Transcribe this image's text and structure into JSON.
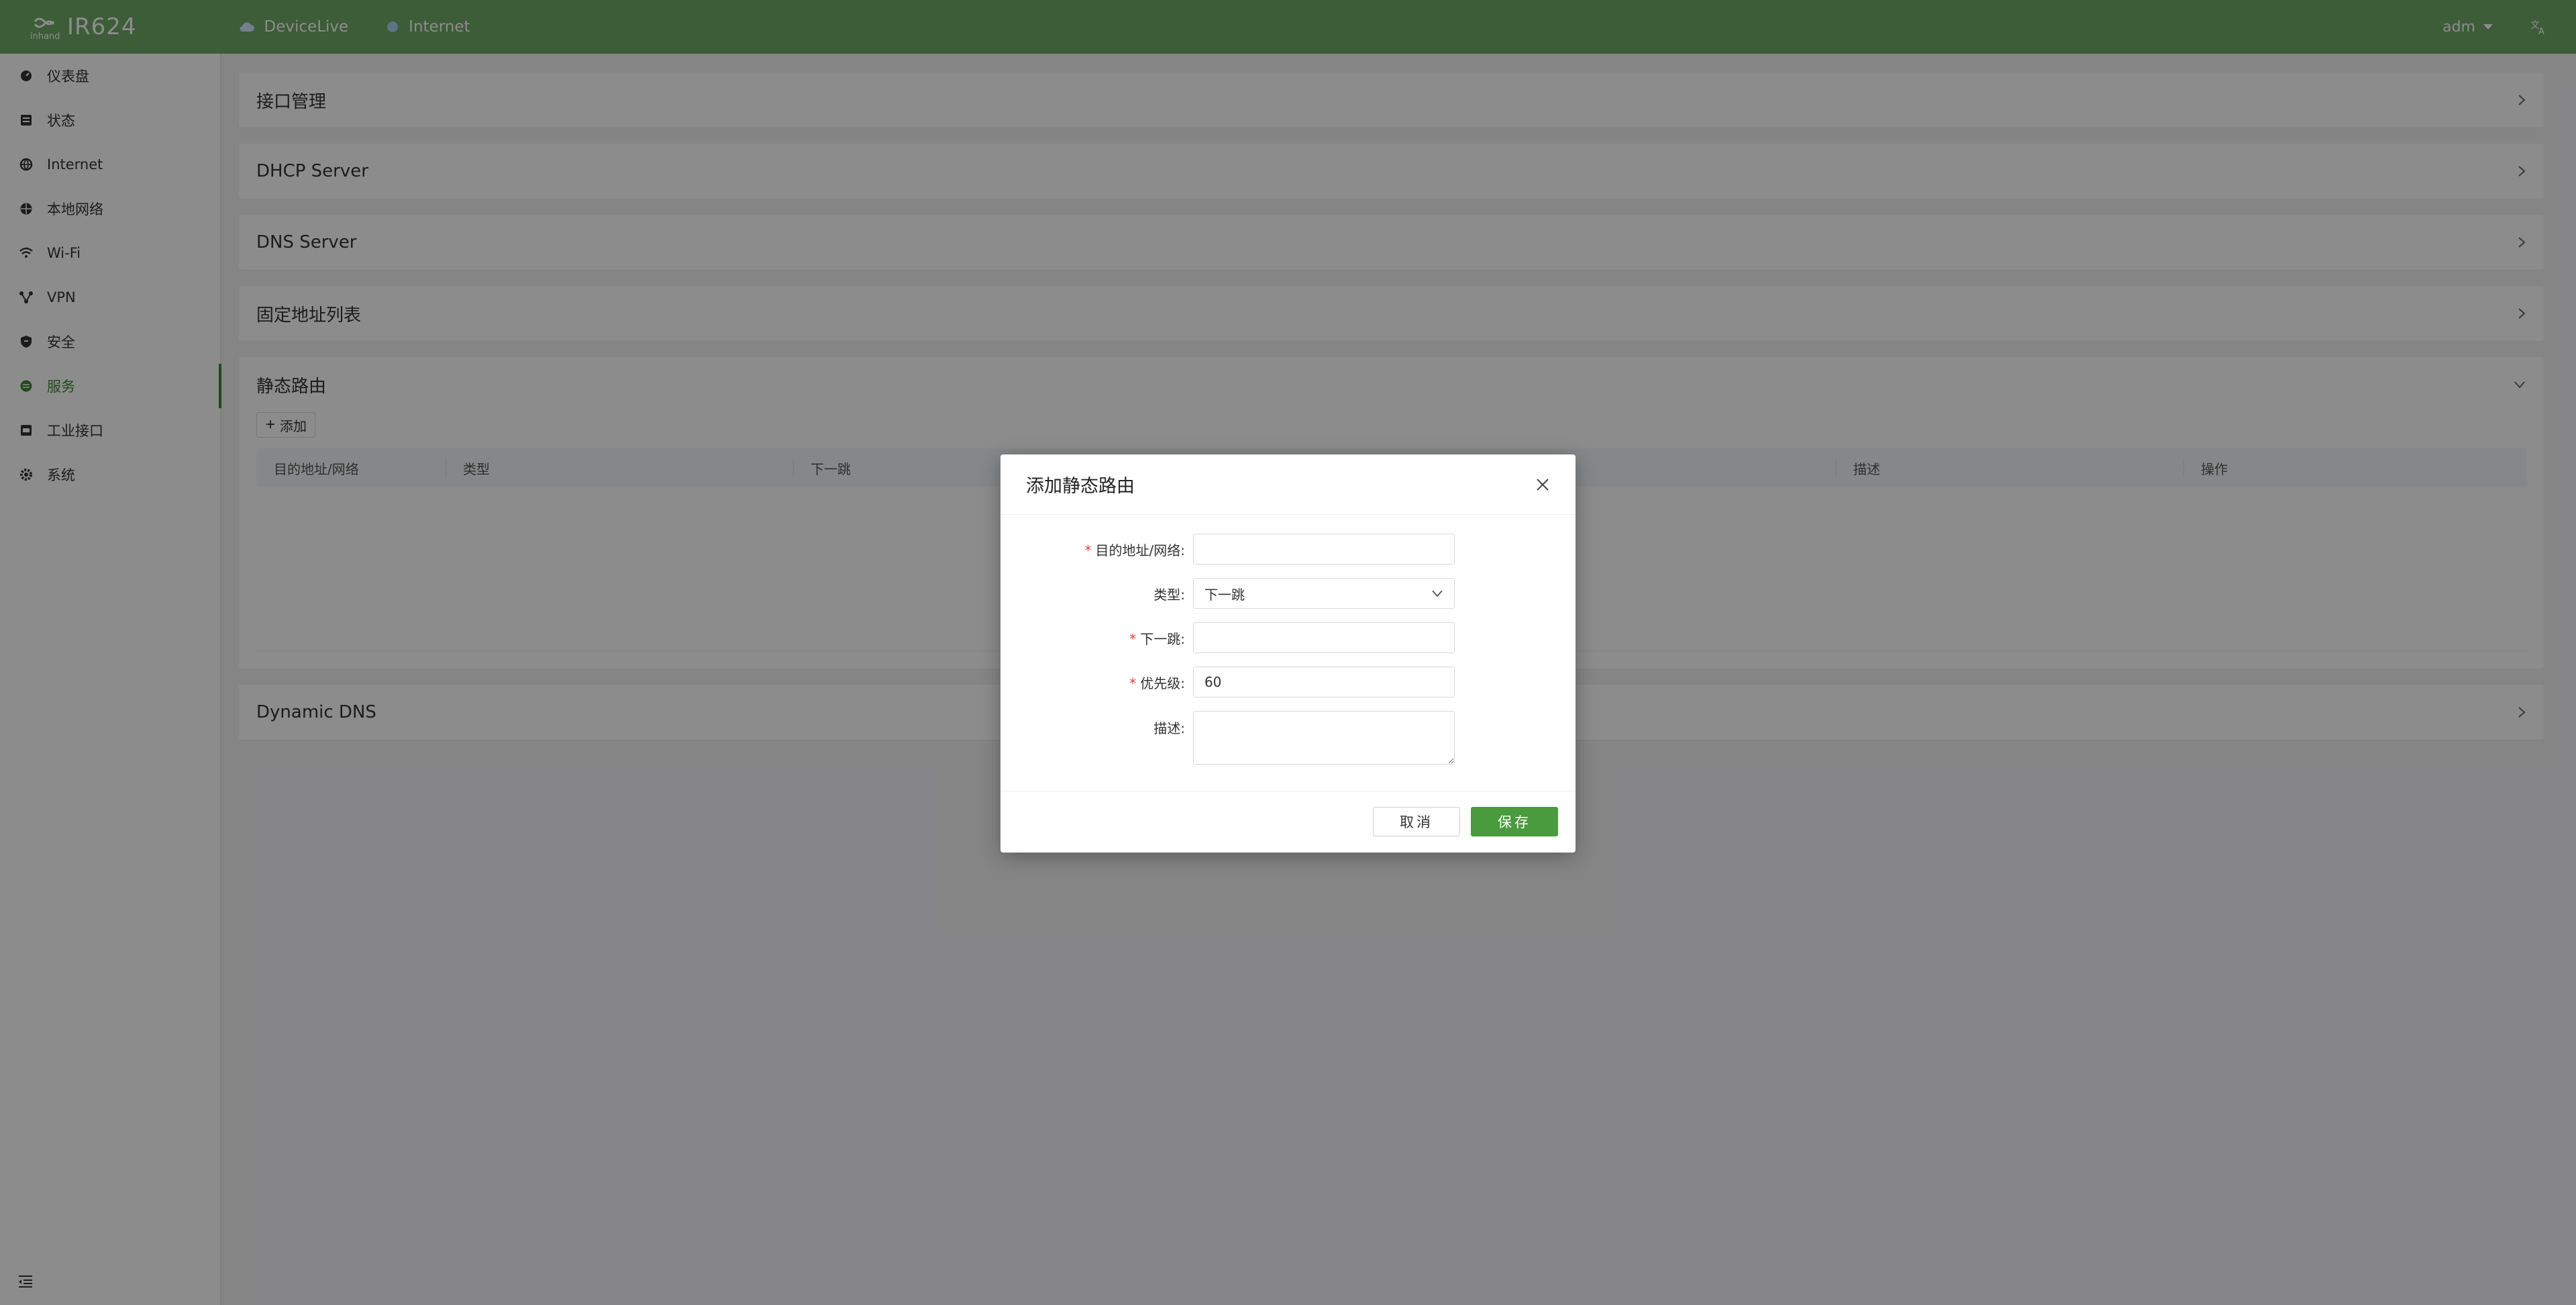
{
  "header": {
    "logo_small": "inhand",
    "model": "IR624",
    "links": [
      {
        "label": "DeviceLive",
        "icon": "cloud-icon"
      },
      {
        "label": "Internet",
        "icon": "globe-dot-icon"
      }
    ],
    "user": "adm",
    "lang_icon": "translate-icon"
  },
  "sidebar": {
    "items": [
      {
        "label": "仪表盘",
        "icon": "dashboard-icon"
      },
      {
        "label": "状态",
        "icon": "status-icon"
      },
      {
        "label": "Internet",
        "icon": "internet-icon"
      },
      {
        "label": "本地网络",
        "icon": "local-network-icon"
      },
      {
        "label": "Wi-Fi",
        "icon": "wifi-icon"
      },
      {
        "label": "VPN",
        "icon": "vpn-icon"
      },
      {
        "label": "安全",
        "icon": "security-icon"
      },
      {
        "label": "服务",
        "icon": "services-icon",
        "active": true
      },
      {
        "label": "工业接口",
        "icon": "industrial-interface-icon"
      },
      {
        "label": "系统",
        "icon": "system-icon"
      }
    ],
    "collapse_icon": "collapse-menu-icon"
  },
  "panels": {
    "interface": "接口管理",
    "dhcp": "DHCP Server",
    "dns": "DNS Server",
    "fixed": "固定地址列表",
    "static_route": "静态路由",
    "ddns": "Dynamic DNS"
  },
  "static_route": {
    "add_label": "添加",
    "columns": [
      "目的地址/网络",
      "类型",
      "下一跳",
      "",
      "",
      "描述",
      "操作"
    ]
  },
  "modal": {
    "title": "添加静态路由",
    "fields": {
      "dest_label": "目的地址/网络",
      "dest_value": "",
      "type_label": "类型",
      "type_value": "下一跳",
      "nexthop_label": "下一跳",
      "nexthop_value": "",
      "priority_label": "优先级",
      "priority_value": "60",
      "desc_label": "描述",
      "desc_value": ""
    },
    "colon": ":",
    "cancel": "取消",
    "save": "保存"
  },
  "colors": {
    "header": "#6fa866",
    "accent": "#3c8a34",
    "save": "#4a9a3e",
    "required": "#e0413a"
  }
}
